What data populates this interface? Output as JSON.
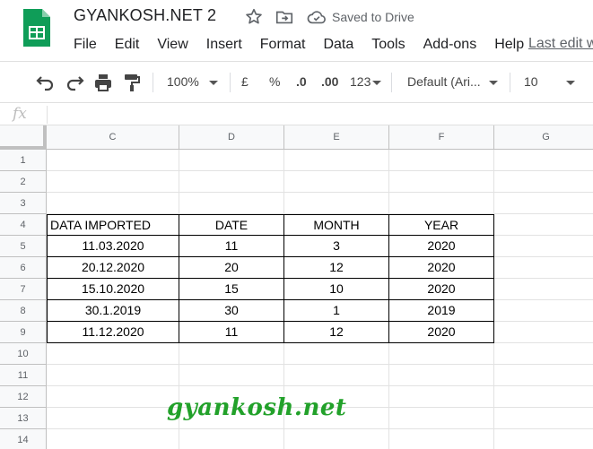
{
  "document": {
    "title": "GYANKOSH.NET 2",
    "save_status": "Saved to Drive"
  },
  "menu": {
    "items": [
      "File",
      "Edit",
      "View",
      "Insert",
      "Format",
      "Data",
      "Tools",
      "Add-ons",
      "Help"
    ],
    "last_edit": "Last edit w"
  },
  "toolbar": {
    "zoom": "100%",
    "currency": "£",
    "percent": "%",
    "decrease_decimal": ".0",
    "increase_decimal": ".00",
    "more_formats": "123",
    "font": "Default (Ari...",
    "font_size": "10"
  },
  "formula_bar": {
    "fx_label": "fx"
  },
  "sheet": {
    "columns": [
      "C",
      "D",
      "E",
      "F",
      "G"
    ],
    "rows": [
      "1",
      "2",
      "3",
      "4",
      "5",
      "6",
      "7",
      "8",
      "9",
      "10",
      "11",
      "12",
      "13",
      "14"
    ],
    "table": {
      "headers": [
        "DATA IMPORTED",
        "DATE",
        "MONTH",
        "YEAR"
      ],
      "data": [
        [
          "11.03.2020",
          "11",
          "3",
          "2020"
        ],
        [
          "20.12.2020",
          "20",
          "12",
          "2020"
        ],
        [
          "15.10.2020",
          "15",
          "10",
          "2020"
        ],
        [
          "30.1.2019",
          "30",
          "1",
          "2019"
        ],
        [
          "11.12.2020",
          "11",
          "12",
          "2020"
        ]
      ]
    }
  },
  "watermark": "gyankosh.net"
}
